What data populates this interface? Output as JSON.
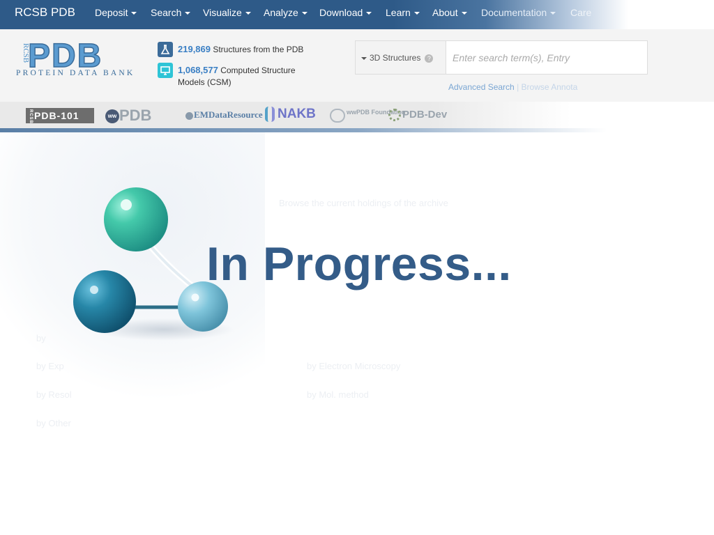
{
  "nav": {
    "brand": "RCSB PDB",
    "items": [
      {
        "label": "Deposit"
      },
      {
        "label": "Search"
      },
      {
        "label": "Visualize"
      },
      {
        "label": "Analyze"
      },
      {
        "label": "Download"
      },
      {
        "label": "Learn"
      },
      {
        "label": "About"
      },
      {
        "label": "Documentation"
      },
      {
        "label": "Care"
      }
    ]
  },
  "logo": {
    "side_text": "RCSB",
    "main_text": "PDB",
    "sub_text": "PROTEIN DATA BANK"
  },
  "stats": {
    "pdb_count": "219,869",
    "pdb_text": "Structures from the PDB",
    "csm_count": "1,068,577",
    "csm_text": "Computed Structure",
    "csm_text2": "Models (CSM)"
  },
  "search": {
    "type_label": "3D Structures",
    "help": "?",
    "placeholder": "Enter search term(s), Entry",
    "advanced_label": "Advanced Search",
    "separator": "|",
    "browse_label": "Browse Annota"
  },
  "partners": [
    "PDB-101",
    "PDB",
    "EMDataResource",
    "NAKB",
    "wwPDB Foundation",
    "PDB-Dev"
  ],
  "partner_prefixes": {
    "pdb101": "RCSB",
    "wwpdb": "ww"
  },
  "faint_text": {
    "holdings": "Browse the current holdings of the archive",
    "by_1": "by",
    "by_exp": "by Exp",
    "em": "by Electron Microscopy",
    "by_res": "by Resol",
    "mol_method": "by Mol. method",
    "by_other": "by Other"
  },
  "overlay": {
    "title": "In Progress..."
  },
  "colors": {
    "nav_bg": "#2e5a88",
    "accent_blue": "#3a7fc4",
    "title_blue": "#345c88",
    "molecule_teal": "#3fc1a8",
    "molecule_blue": "#1f7a9c"
  }
}
